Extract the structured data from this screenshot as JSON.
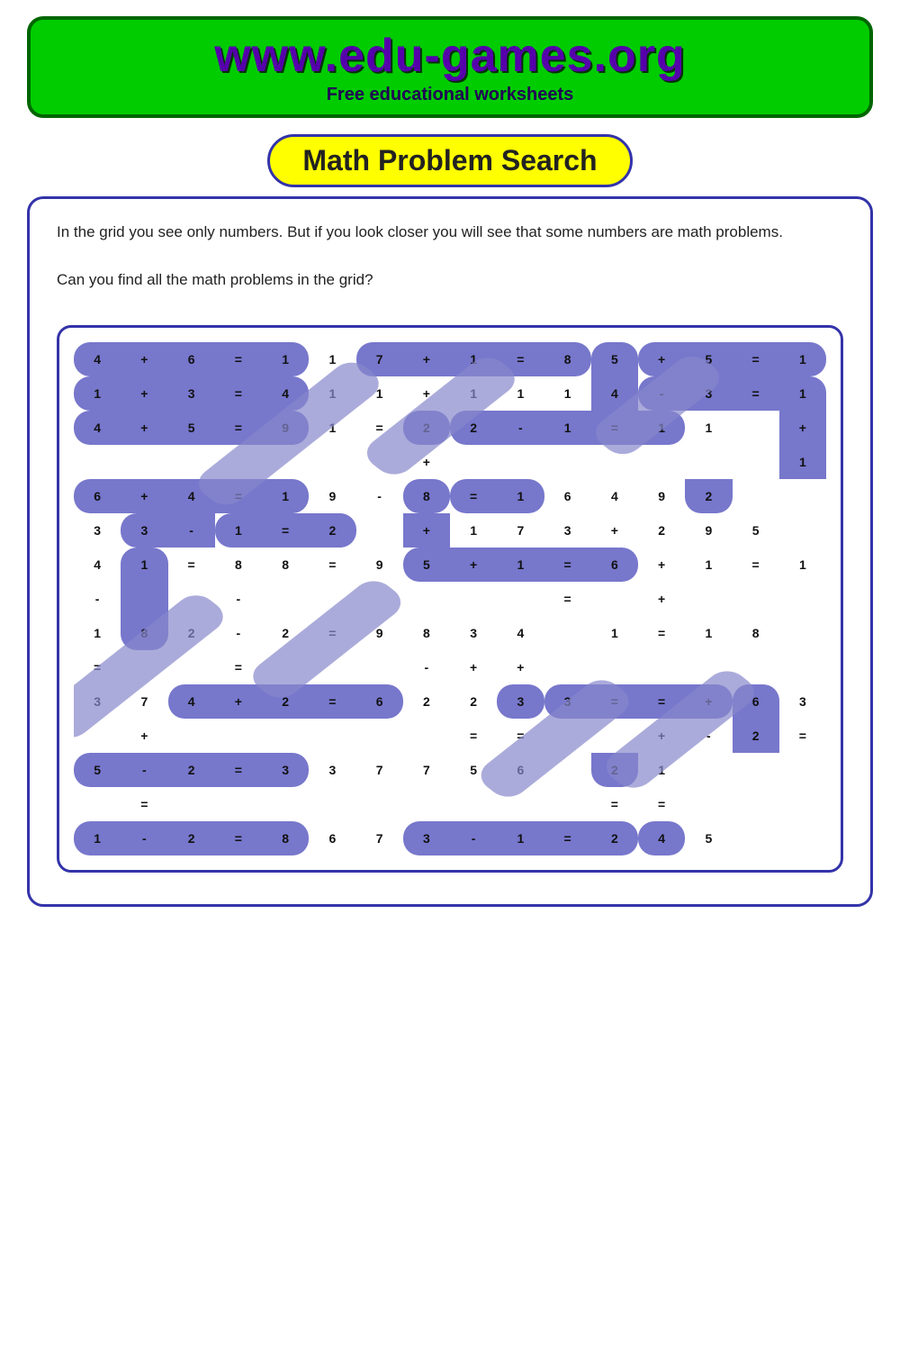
{
  "header": {
    "url": "www.edu-games.org",
    "subtitle": "Free educational worksheets"
  },
  "page": {
    "title": "Math Problem Search",
    "description1": "In the grid you see only numbers. But if you look closer you will see that some numbers are math problems.",
    "description2": "Can you find all the math problems in the grid?"
  },
  "colors": {
    "header_bg": "#00cc00",
    "header_border": "#006600",
    "title_color": "#5500aa",
    "subtitle_color": "#220055",
    "page_border": "#3333aa",
    "title_badge_bg": "#ffff00",
    "pill_bg": "#7777cc",
    "diag_bg": "#9999dd"
  }
}
